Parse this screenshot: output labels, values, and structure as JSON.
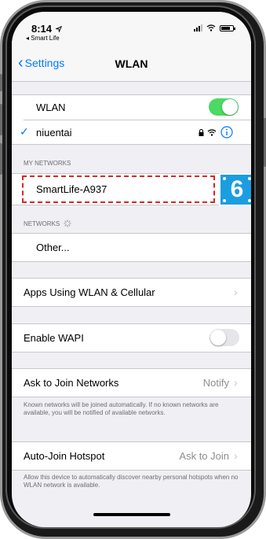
{
  "status_bar": {
    "time": "8:14",
    "location_arrow": "location-arrow-icon",
    "back_app": "◂ Smart Life"
  },
  "nav": {
    "back_label": "Settings",
    "title": "WLAN"
  },
  "wlan": {
    "label": "WLAN",
    "enabled": true
  },
  "connected": {
    "name": "niuentai"
  },
  "my_networks": {
    "header": "MY NETWORKS",
    "items": [
      {
        "name": "SmartLife-A937"
      }
    ]
  },
  "networks": {
    "header": "NETWORKS",
    "other_label": "Other..."
  },
  "apps_using": {
    "label": "Apps Using WLAN & Cellular"
  },
  "wapi": {
    "label": "Enable WAPI",
    "enabled": false
  },
  "ask_join": {
    "label": "Ask to Join Networks",
    "value": "Notify",
    "footer": "Known networks will be joined automatically. If no known networks are available, you will be notified of available networks."
  },
  "auto_join": {
    "label": "Auto-Join Hotspot",
    "value": "Ask to Join",
    "footer": "Allow this device to automatically discover nearby personal hotspots when no WLAN network is available."
  },
  "annotation": {
    "step_number": "6"
  },
  "colors": {
    "accent": "#007aff",
    "toggle_on": "#4cd964",
    "toggle_off": "#e5e5ea",
    "highlight": "#d9262b",
    "badge": "#1b9ee0"
  }
}
